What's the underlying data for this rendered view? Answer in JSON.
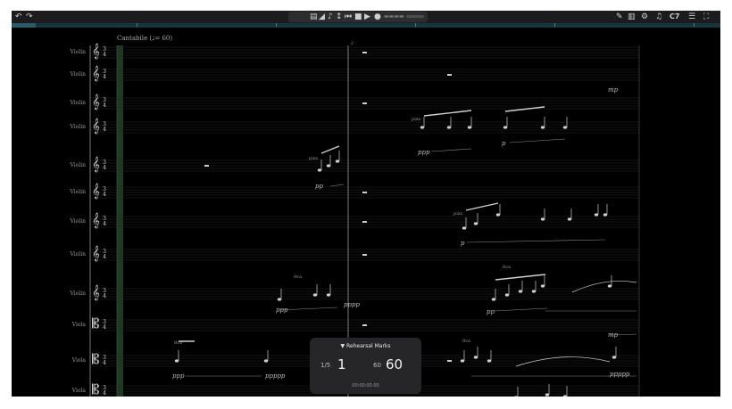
{
  "toolbar": {
    "undo_icon": "undo-icon",
    "redo_icon": "redo-icon",
    "key_label": "C7",
    "center_icons": [
      "loop-icon",
      "mixer-icon",
      "metronome-icon",
      "tuner-icon",
      "rewind-icon",
      "stop-icon",
      "play-icon",
      "record-icon"
    ]
  },
  "score": {
    "tempo_text": "Cantabile (♩= 60)",
    "measure_number": "2",
    "staves": [
      {
        "name": "Violin",
        "clef": "𝄞",
        "ts_top": "3",
        "ts_bottom": "4"
      },
      {
        "name": "Violin",
        "clef": "𝄞",
        "ts_top": "3",
        "ts_bottom": "4"
      },
      {
        "name": "Violin",
        "clef": "𝄞",
        "ts_top": "3",
        "ts_bottom": "4"
      },
      {
        "name": "Violin",
        "clef": "𝄞",
        "ts_top": "3",
        "ts_bottom": "4"
      },
      {
        "name": "Violin",
        "clef": "𝄞",
        "ts_top": "3",
        "ts_bottom": "4"
      },
      {
        "name": "Violin",
        "clef": "𝄞",
        "ts_top": "3",
        "ts_bottom": "4"
      },
      {
        "name": "Violin",
        "clef": "𝄞",
        "ts_top": "3",
        "ts_bottom": "4"
      },
      {
        "name": "Violin",
        "clef": "𝄞",
        "ts_top": "3",
        "ts_bottom": "4"
      },
      {
        "name": "Violin",
        "clef": "𝄞",
        "ts_top": "3",
        "ts_bottom": "4"
      },
      {
        "name": "Viola",
        "clef": "𝄡",
        "ts_top": "3",
        "ts_bottom": "4"
      },
      {
        "name": "Viola",
        "clef": "𝄡",
        "ts_top": "3",
        "ts_bottom": "4"
      },
      {
        "name": "Viola",
        "clef": "𝄡",
        "ts_top": "3",
        "ts_bottom": "4"
      }
    ],
    "dynamics": [
      "mp",
      "ppp",
      "pizz.",
      "p",
      "pp",
      "pizz.",
      "p",
      "ppp",
      "pizz.",
      "pp",
      "pppp",
      "pp",
      "mp",
      "ppp",
      "ppppp",
      "ppppp",
      "8va",
      "8va",
      "8va",
      "8va"
    ]
  },
  "rehearsal_panel": {
    "title": "▼ Rehearsal Marks",
    "position_label": "1/5",
    "position_value": "1",
    "tempo_label": "60",
    "tempo_value": "60",
    "time": "00:00:00.00"
  }
}
